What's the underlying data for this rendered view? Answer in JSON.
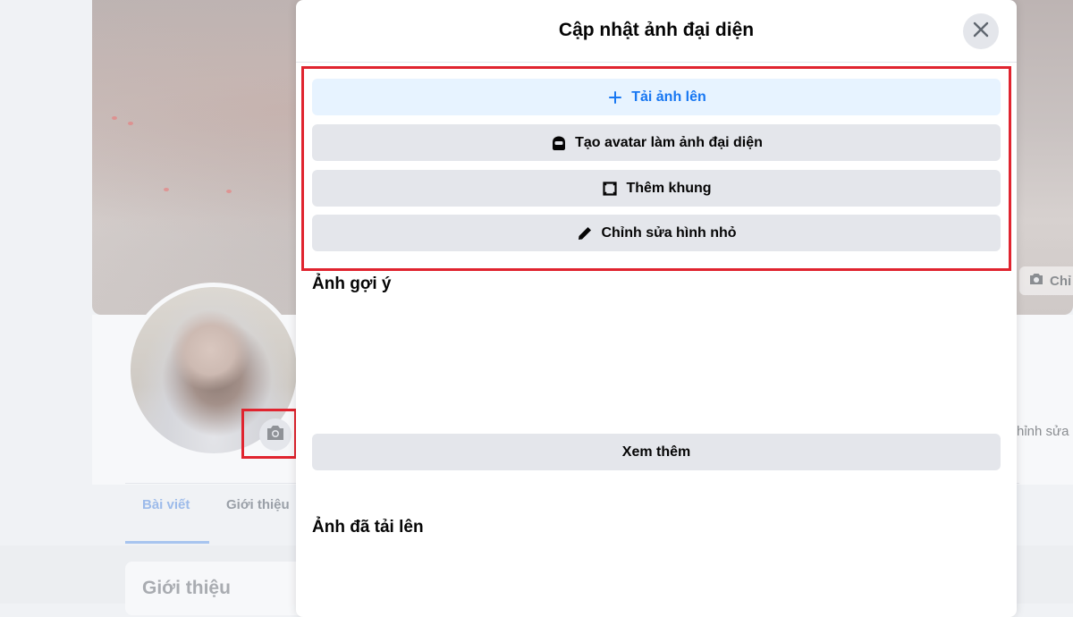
{
  "background": {
    "cover_button_label": "Chỉ",
    "edit_profile_label": "hỉnh sửa",
    "tabs": [
      {
        "label": "Bài viết",
        "active": true
      },
      {
        "label": "Giới thiệu",
        "active": false
      }
    ],
    "intro_card_title": "Giới thiệu",
    "icons": [
      "camera-icon",
      "avatar-camera-icon"
    ]
  },
  "modal": {
    "title": "Cập nhật ảnh đại diện",
    "close_icon": "close-icon",
    "actions": [
      {
        "label": "Tải ảnh lên",
        "icon": "plus-icon",
        "primary": true
      },
      {
        "label": "Tạo avatar làm ảnh đại diện",
        "icon": "avatar-face-icon",
        "primary": false
      },
      {
        "label": "Thêm khung",
        "icon": "frame-icon",
        "primary": false
      },
      {
        "label": "Chỉnh sửa hình nhỏ",
        "icon": "pencil-icon",
        "primary": false
      }
    ],
    "suggested_title": "Ảnh gợi ý",
    "see_more_label": "Xem thêm",
    "uploaded_title": "Ảnh đã tải lên"
  },
  "colors": {
    "accent_blue": "#1877f2",
    "primary_button_bg": "#e7f3ff",
    "button_bg": "#e4e6eb",
    "highlight_red": "#e0242f"
  }
}
